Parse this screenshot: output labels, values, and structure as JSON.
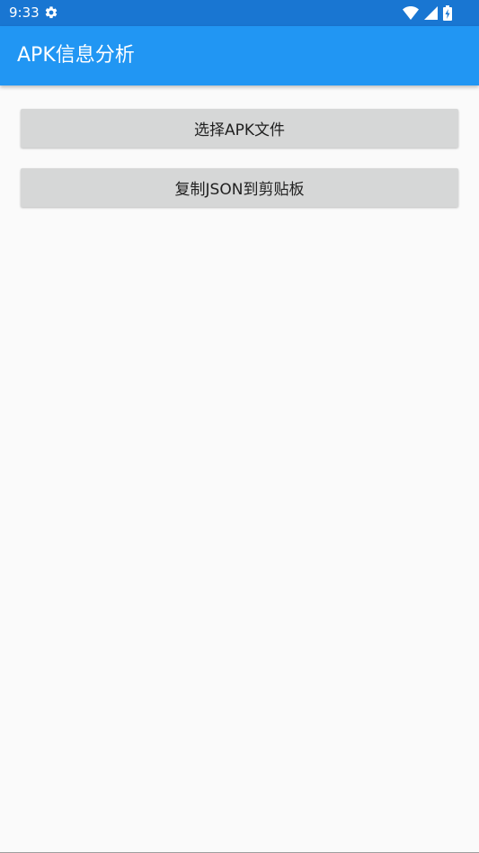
{
  "status_bar": {
    "time": "9:33",
    "icons": [
      "settings-gear-icon",
      "wifi-icon",
      "cell-signal-icon",
      "battery-charging-icon"
    ]
  },
  "app_bar": {
    "title": "APK信息分析"
  },
  "buttons": {
    "select_apk": "选择APK文件",
    "copy_json": "复制JSON到剪贴板"
  },
  "colors": {
    "status_bar": "#1976d2",
    "app_bar": "#2196f3",
    "button_bg": "#d6d7d7",
    "background": "#fafafa"
  }
}
